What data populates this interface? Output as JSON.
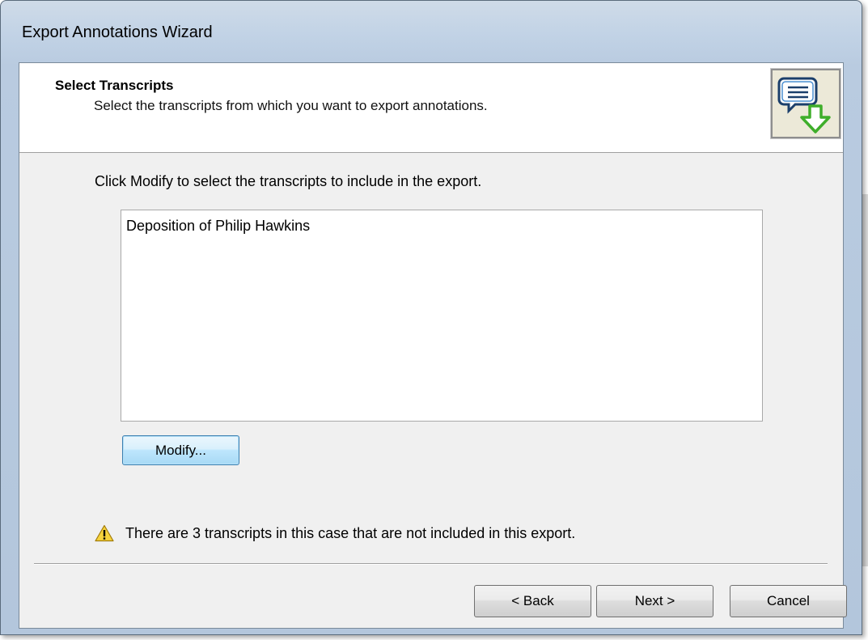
{
  "window": {
    "title": "Export Annotations Wizard"
  },
  "header": {
    "title": "Select Transcripts",
    "subtitle": "Select the transcripts from which you want to export annotations.",
    "icon": "annotation-export-icon"
  },
  "body": {
    "instruction": "Click Modify to select the transcripts to include in the export.",
    "transcripts": [
      "Deposition of Philip Hawkins"
    ],
    "modify_label": "Modify...",
    "warning_icon": "warning-icon",
    "warning_text": "There are 3 transcripts in this case that are not included in this export."
  },
  "footer": {
    "back_label": "< Back",
    "next_label": "Next >",
    "cancel_label": "Cancel"
  },
  "colors": {
    "title_bar": "#c2d3e6",
    "dialog_bg": "#f0f0f0",
    "icon_bg": "#ece9d8",
    "arrow_green": "#3fae2a",
    "focus_border": "#3c7fb1"
  }
}
